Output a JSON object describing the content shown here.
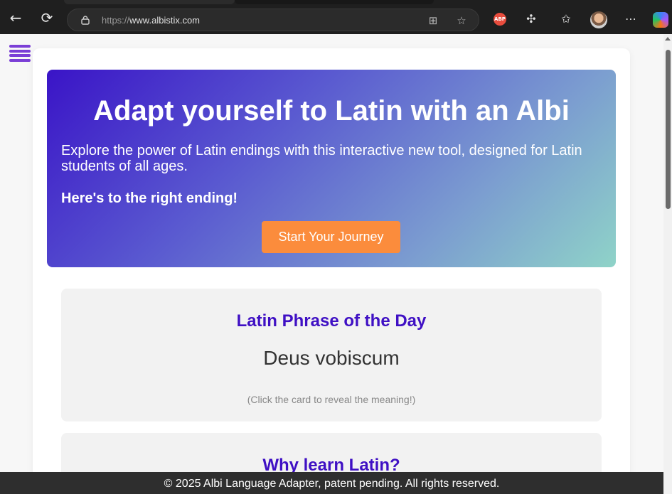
{
  "browser": {
    "url_protocol": "https://",
    "url_host": "www.albistix.com",
    "extension_label": "ABP"
  },
  "hero": {
    "title": "Adapt yourself to Latin with an Albi",
    "description": "Explore the power of Latin endings with this interactive new tool, designed for Latin students of all ages.",
    "tagline": "Here's to the right ending!",
    "cta_label": "Start Your Journey"
  },
  "phrase_card": {
    "heading": "Latin Phrase of the Day",
    "phrase": "Deus vobiscum",
    "hint": "(Click the card to reveal the meaning!)"
  },
  "why_card": {
    "heading": "Why learn Latin?"
  },
  "footer": {
    "text": "© 2025 Albi Language Adapter, patent pending. All rights reserved."
  },
  "colors": {
    "accent_purple": "#3f10c4",
    "cta_orange": "#fb8c3c",
    "menu_purple": "#7b3fd6",
    "footer_bg": "#2e2e2e"
  }
}
